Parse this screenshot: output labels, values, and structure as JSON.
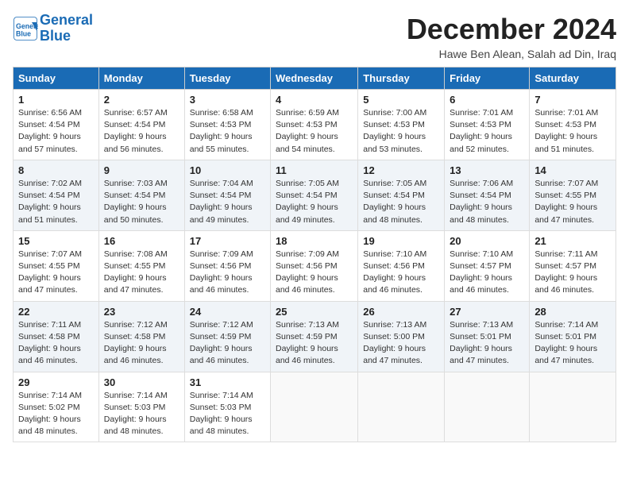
{
  "header": {
    "logo_line1": "General",
    "logo_line2": "Blue",
    "title": "December 2024",
    "location": "Hawe Ben Alean, Salah ad Din, Iraq"
  },
  "days_of_week": [
    "Sunday",
    "Monday",
    "Tuesday",
    "Wednesday",
    "Thursday",
    "Friday",
    "Saturday"
  ],
  "weeks": [
    [
      {
        "day": 1,
        "sunrise": "6:56 AM",
        "sunset": "4:54 PM",
        "daylight": "9 hours and 57 minutes."
      },
      {
        "day": 2,
        "sunrise": "6:57 AM",
        "sunset": "4:54 PM",
        "daylight": "9 hours and 56 minutes."
      },
      {
        "day": 3,
        "sunrise": "6:58 AM",
        "sunset": "4:53 PM",
        "daylight": "9 hours and 55 minutes."
      },
      {
        "day": 4,
        "sunrise": "6:59 AM",
        "sunset": "4:53 PM",
        "daylight": "9 hours and 54 minutes."
      },
      {
        "day": 5,
        "sunrise": "7:00 AM",
        "sunset": "4:53 PM",
        "daylight": "9 hours and 53 minutes."
      },
      {
        "day": 6,
        "sunrise": "7:01 AM",
        "sunset": "4:53 PM",
        "daylight": "9 hours and 52 minutes."
      },
      {
        "day": 7,
        "sunrise": "7:01 AM",
        "sunset": "4:53 PM",
        "daylight": "9 hours and 51 minutes."
      }
    ],
    [
      {
        "day": 8,
        "sunrise": "7:02 AM",
        "sunset": "4:54 PM",
        "daylight": "9 hours and 51 minutes."
      },
      {
        "day": 9,
        "sunrise": "7:03 AM",
        "sunset": "4:54 PM",
        "daylight": "9 hours and 50 minutes."
      },
      {
        "day": 10,
        "sunrise": "7:04 AM",
        "sunset": "4:54 PM",
        "daylight": "9 hours and 49 minutes."
      },
      {
        "day": 11,
        "sunrise": "7:05 AM",
        "sunset": "4:54 PM",
        "daylight": "9 hours and 49 minutes."
      },
      {
        "day": 12,
        "sunrise": "7:05 AM",
        "sunset": "4:54 PM",
        "daylight": "9 hours and 48 minutes."
      },
      {
        "day": 13,
        "sunrise": "7:06 AM",
        "sunset": "4:54 PM",
        "daylight": "9 hours and 48 minutes."
      },
      {
        "day": 14,
        "sunrise": "7:07 AM",
        "sunset": "4:55 PM",
        "daylight": "9 hours and 47 minutes."
      }
    ],
    [
      {
        "day": 15,
        "sunrise": "7:07 AM",
        "sunset": "4:55 PM",
        "daylight": "9 hours and 47 minutes."
      },
      {
        "day": 16,
        "sunrise": "7:08 AM",
        "sunset": "4:55 PM",
        "daylight": "9 hours and 47 minutes."
      },
      {
        "day": 17,
        "sunrise": "7:09 AM",
        "sunset": "4:56 PM",
        "daylight": "9 hours and 46 minutes."
      },
      {
        "day": 18,
        "sunrise": "7:09 AM",
        "sunset": "4:56 PM",
        "daylight": "9 hours and 46 minutes."
      },
      {
        "day": 19,
        "sunrise": "7:10 AM",
        "sunset": "4:56 PM",
        "daylight": "9 hours and 46 minutes."
      },
      {
        "day": 20,
        "sunrise": "7:10 AM",
        "sunset": "4:57 PM",
        "daylight": "9 hours and 46 minutes."
      },
      {
        "day": 21,
        "sunrise": "7:11 AM",
        "sunset": "4:57 PM",
        "daylight": "9 hours and 46 minutes."
      }
    ],
    [
      {
        "day": 22,
        "sunrise": "7:11 AM",
        "sunset": "4:58 PM",
        "daylight": "9 hours and 46 minutes."
      },
      {
        "day": 23,
        "sunrise": "7:12 AM",
        "sunset": "4:58 PM",
        "daylight": "9 hours and 46 minutes."
      },
      {
        "day": 24,
        "sunrise": "7:12 AM",
        "sunset": "4:59 PM",
        "daylight": "9 hours and 46 minutes."
      },
      {
        "day": 25,
        "sunrise": "7:13 AM",
        "sunset": "4:59 PM",
        "daylight": "9 hours and 46 minutes."
      },
      {
        "day": 26,
        "sunrise": "7:13 AM",
        "sunset": "5:00 PM",
        "daylight": "9 hours and 47 minutes."
      },
      {
        "day": 27,
        "sunrise": "7:13 AM",
        "sunset": "5:01 PM",
        "daylight": "9 hours and 47 minutes."
      },
      {
        "day": 28,
        "sunrise": "7:14 AM",
        "sunset": "5:01 PM",
        "daylight": "9 hours and 47 minutes."
      }
    ],
    [
      {
        "day": 29,
        "sunrise": "7:14 AM",
        "sunset": "5:02 PM",
        "daylight": "9 hours and 48 minutes."
      },
      {
        "day": 30,
        "sunrise": "7:14 AM",
        "sunset": "5:03 PM",
        "daylight": "9 hours and 48 minutes."
      },
      {
        "day": 31,
        "sunrise": "7:14 AM",
        "sunset": "5:03 PM",
        "daylight": "9 hours and 48 minutes."
      },
      null,
      null,
      null,
      null
    ]
  ]
}
